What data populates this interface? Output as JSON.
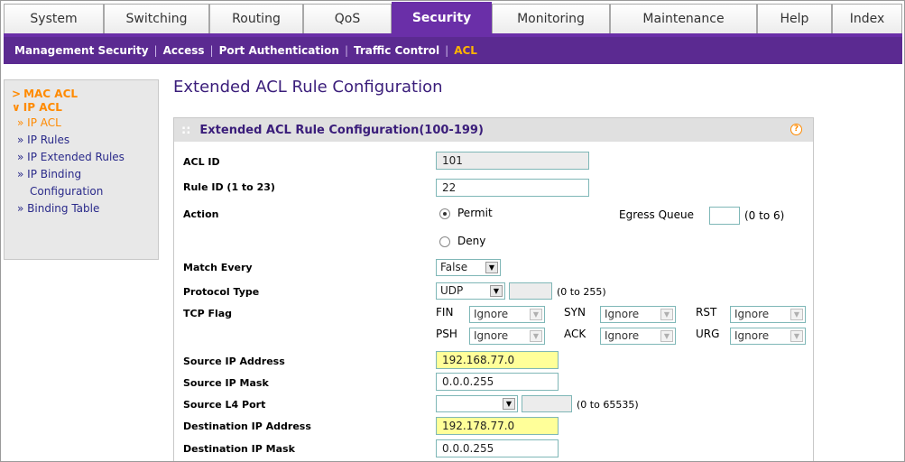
{
  "tabs": [
    {
      "label": "System",
      "active": false
    },
    {
      "label": "Switching",
      "active": false
    },
    {
      "label": "Routing",
      "active": false
    },
    {
      "label": "QoS",
      "active": false
    },
    {
      "label": "Security",
      "active": true
    },
    {
      "label": "Monitoring",
      "active": false
    },
    {
      "label": "Maintenance",
      "active": false
    },
    {
      "label": "Help",
      "active": false
    },
    {
      "label": "Index",
      "active": false
    }
  ],
  "subnav": {
    "items": [
      "Management Security",
      "Access",
      "Port Authentication",
      "Traffic Control",
      "ACL"
    ],
    "current": "ACL"
  },
  "sidebar": {
    "mac_acl": "MAC ACL",
    "ip_acl": "IP ACL",
    "items": [
      "» IP ACL",
      "» IP Rules",
      "» IP Extended Rules",
      "» IP Binding",
      "Configuration",
      "» Binding Table"
    ],
    "group_arrow_closed": ">",
    "group_arrow_open": "∨"
  },
  "page_title": "Extended ACL Rule Configuration",
  "panel": {
    "title": "Extended ACL Rule Configuration(100-199)",
    "help": "?"
  },
  "form": {
    "acl_id": {
      "label": "ACL ID",
      "value": "101"
    },
    "rule_id": {
      "label": "Rule ID (1 to 23)",
      "value": "22"
    },
    "action": {
      "label": "Action",
      "permit": "Permit",
      "deny": "Deny",
      "selected": "Permit",
      "egress_label": "Egress Queue",
      "egress_value": "",
      "egress_range": "(0 to 6)"
    },
    "match_every": {
      "label": "Match Every",
      "value": "False"
    },
    "protocol": {
      "label": "Protocol Type",
      "value": "UDP",
      "extra_value": "",
      "range": "(0 to 255)"
    },
    "tcp_flag": {
      "label": "TCP Flag",
      "flags": [
        {
          "name": "FIN",
          "value": "Ignore"
        },
        {
          "name": "SYN",
          "value": "Ignore"
        },
        {
          "name": "RST",
          "value": "Ignore"
        },
        {
          "name": "PSH",
          "value": "Ignore"
        },
        {
          "name": "ACK",
          "value": "Ignore"
        },
        {
          "name": "URG",
          "value": "Ignore"
        }
      ]
    },
    "src_ip": {
      "label": "Source IP Address",
      "value": "192.168.77.0"
    },
    "src_mask": {
      "label": "Source IP Mask",
      "value": "0.0.0.255"
    },
    "src_l4": {
      "label": "Source L4 Port",
      "value": "",
      "extra_value": "",
      "range": "(0 to 65535)"
    },
    "dst_ip": {
      "label": "Destination IP Address",
      "value": "192.178.77.0"
    },
    "dst_mask": {
      "label": "Destination IP Mask",
      "value": "0.0.0.255"
    }
  },
  "colors": {
    "brand_purple": "#6a2fa8",
    "subnav_bg": "#5b2a91",
    "accent_orange": "#ff8a00",
    "highlight_yellow": "#ffff99",
    "title_purple": "#3a1d7a"
  }
}
